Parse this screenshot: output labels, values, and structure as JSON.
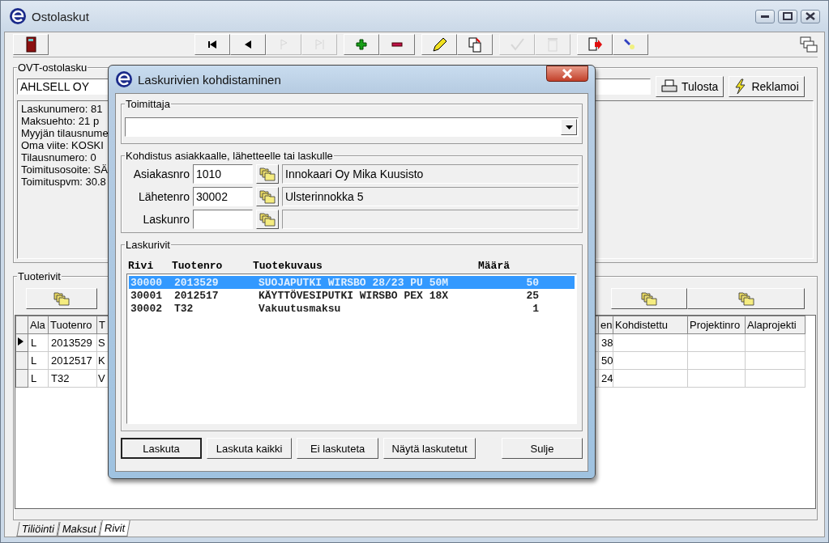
{
  "window": {
    "title": "Ostolaskut"
  },
  "toolbar": [
    {
      "kind": "exit",
      "disabled": false
    },
    {
      "kind": "first",
      "disabled": false
    },
    {
      "kind": "prev",
      "disabled": false
    },
    {
      "kind": "next",
      "disabled": true
    },
    {
      "kind": "last",
      "disabled": true
    },
    {
      "kind": "add",
      "disabled": false
    },
    {
      "kind": "remove",
      "disabled": false
    },
    {
      "kind": "edit",
      "disabled": false
    },
    {
      "kind": "copy",
      "disabled": false
    },
    {
      "kind": "accept",
      "disabled": true
    },
    {
      "kind": "delete",
      "disabled": true
    },
    {
      "kind": "export",
      "disabled": false
    },
    {
      "kind": "search",
      "disabled": false
    }
  ],
  "invoice_group": {
    "title": "OVT-ostolasku",
    "supplier": "AHLSELL OY",
    "buttons": [
      {
        "kind": "print",
        "label": "Tulosta"
      },
      {
        "kind": "claim",
        "label": "Reklamoi"
      }
    ],
    "details": [
      "Laskunumero: 81",
      "Maksuehto: 21 p",
      "Myyjän tilausnume",
      "Oma viite: KOSKI",
      "Tilausnumero: 0",
      "Toimitusosoite: SÄ",
      "Toimituspvm: 30.8"
    ]
  },
  "product_rows": {
    "title": "Tuoterivit",
    "columns": [
      "Ala",
      "Tuotenro",
      "T",
      "en",
      "Kohdistettu",
      "Projektinro",
      "Alaprojekti"
    ],
    "rows": [
      {
        "selected": true,
        "cells": [
          "L",
          "2013529",
          "S",
          "38",
          "",
          "",
          ""
        ]
      },
      {
        "selected": false,
        "cells": [
          "L",
          "2012517",
          "K",
          "50",
          "",
          "",
          ""
        ]
      },
      {
        "selected": false,
        "cells": [
          "L",
          "T32",
          "V",
          "24",
          "",
          "",
          ""
        ]
      }
    ]
  },
  "tabs": [
    {
      "label": "Tiliöinti",
      "selected": false
    },
    {
      "label": "Maksut",
      "selected": false
    },
    {
      "label": "Rivit",
      "selected": true
    }
  ],
  "dialog": {
    "title": "Laskurivien kohdistaminen",
    "supplier_group": {
      "title": "Toimittaja"
    },
    "target_group": {
      "title": "Kohdistus asiakkaalle, lähetteelle tai laskulle",
      "fields": [
        {
          "label": "Asiakasnro",
          "value": "1010",
          "description": "Innokaari Oy Mika Kuusisto"
        },
        {
          "label": "Lähetenro",
          "value": "30002",
          "description": "Ulsterinnokka 5"
        },
        {
          "label": "Laskunro"
        }
      ]
    },
    "lines_group": {
      "title": "Laskurivit",
      "columns": [
        "Rivi",
        "Tuotenro",
        "Tuotekuvaus",
        "Määrä"
      ],
      "rows": [
        {
          "selected": true,
          "row": "30000",
          "product": "2013529",
          "description": "SUOJAPUTKI WIRSBO 28/23 PU 50M",
          "quantity": "50"
        },
        {
          "selected": false,
          "row": "30001",
          "product": "2012517",
          "description": "KÄYTTÖVESIPUTKI WIRSBO PEX 18X",
          "quantity": "25"
        },
        {
          "selected": false,
          "row": "30002",
          "product": "T32",
          "description": "Vakuutusmaksu",
          "quantity": "1"
        }
      ]
    },
    "buttons": [
      {
        "label": "Laskuta",
        "default": true
      },
      {
        "label": "Laskuta kaikki",
        "default": false
      },
      {
        "label": "Ei laskuteta",
        "default": false
      },
      {
        "label": "Näytä laskutetut",
        "default": false
      },
      {
        "label": "Sulje",
        "default": false
      }
    ]
  }
}
